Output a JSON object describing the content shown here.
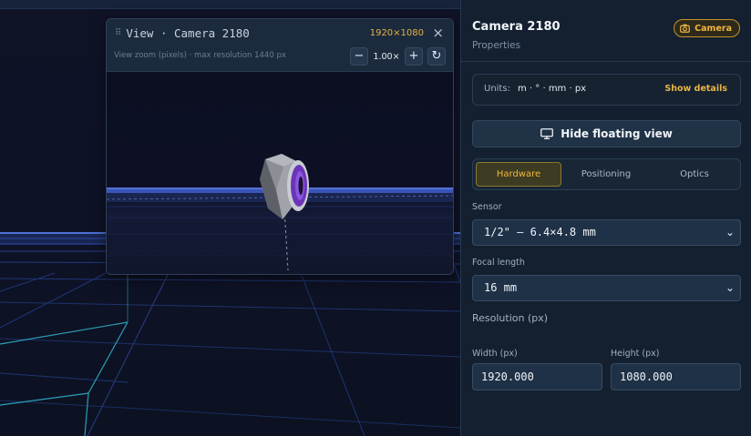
{
  "viewport": {
    "description_icon": "3d-grid-scene"
  },
  "floating_view": {
    "title": "View · Camera 2180",
    "resolution_badge": "1920×1080",
    "close_icon": "×",
    "subtitle": "View zoom (pixels) · max resolution 1440 px",
    "zoom_value": "1.00×",
    "zoom_out_icon": "−",
    "zoom_in_icon": "+",
    "reset_icon": "↻"
  },
  "panel": {
    "title": "Camera 2180",
    "subtitle": "Properties",
    "badge_label": "Camera",
    "units": {
      "label": "Units:",
      "value": "m · ° · mm · px",
      "link": "Show details"
    },
    "hide_button": "Hide floating view",
    "tabs": [
      {
        "label": "Hardware",
        "active": true
      },
      {
        "label": "Positioning",
        "active": false
      },
      {
        "label": "Optics",
        "active": false
      }
    ],
    "sensor": {
      "label": "Sensor",
      "value": "1/2\" — 6.4×4.8 mm"
    },
    "focal_length": {
      "label": "Focal length",
      "value": "16 mm"
    },
    "resolution": {
      "heading": "Resolution (px)",
      "width": {
        "label": "Width (px)",
        "value": "1920.000"
      },
      "height": {
        "label": "Height (px)",
        "value": "1080.000"
      }
    }
  },
  "colors": {
    "accent": "#f0b640",
    "panel_bg": "#14202f",
    "grid_line": "#2d4fa8"
  }
}
